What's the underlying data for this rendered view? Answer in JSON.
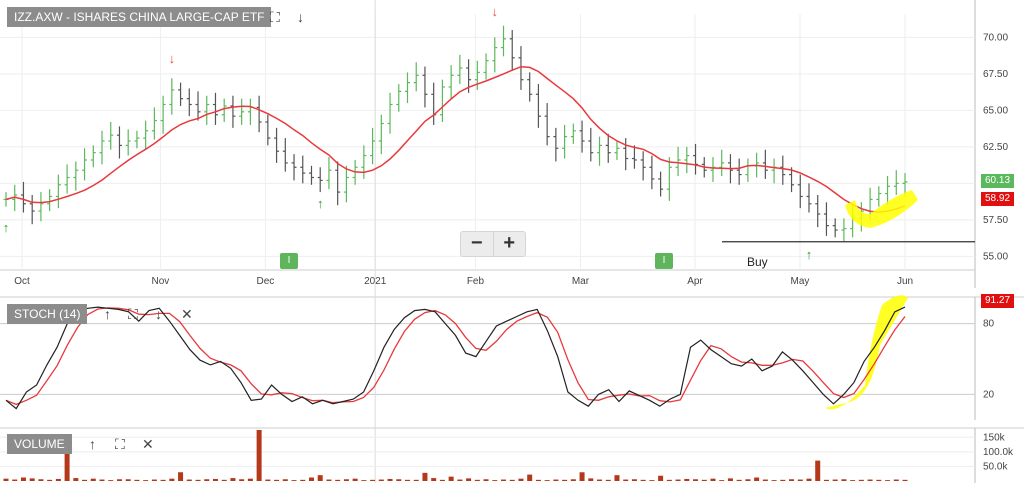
{
  "price_panel": {
    "title": "IZZ.AXW - ISHARES CHINA LARGE-CAP ETF",
    "last_price_label": "60.13",
    "sma_label": "58.92",
    "buy_label": "Buy",
    "event_badges": [
      "I",
      "I"
    ]
  },
  "stoch_panel": {
    "title": "STOCH (14)",
    "value_label": "91.27"
  },
  "volume_panel": {
    "title": "VOLUME"
  },
  "zoom": {
    "minus": "−",
    "plus": "+"
  },
  "colors": {
    "up": "#5cb85c",
    "down": "#555555",
    "sma": "#e8393d",
    "stoch_k": "#222222",
    "stoch_d": "#e8393d",
    "volume": "#b5381b",
    "highlight": "#ffff00",
    "panel_title_bg": "#8c8c8c",
    "last_tag": "#5cb85c",
    "sma_tag": "#e01010"
  },
  "chart_data": [
    {
      "type": "line",
      "name": "price",
      "x_ticks": [
        "Oct",
        "Nov",
        "Dec",
        "2021",
        "Feb",
        "Mar",
        "Apr",
        "May",
        "Jun"
      ],
      "y_ticks": [
        "55.00",
        "57.50",
        "60.00",
        "62.50",
        "65.00",
        "67.50",
        "70.00"
      ],
      "ylim": [
        54.2,
        71.6
      ],
      "grid": true,
      "series": [
        {
          "name": "close",
          "values": [
            58.9,
            59.2,
            58.6,
            58.1,
            58.6,
            59.1,
            59.9,
            60.4,
            60.9,
            61.6,
            62.1,
            62.9,
            63.3,
            62.6,
            62.9,
            63.1,
            63.6,
            64.3,
            65.4,
            66.4,
            65.8,
            65.4,
            64.9,
            65.4,
            64.7,
            65.3,
            64.6,
            64.9,
            65.2,
            64.2,
            63.1,
            62.2,
            61.4,
            61.1,
            60.7,
            60.4,
            60.2,
            60.9,
            59.4,
            60.4,
            61.1,
            61.9,
            62.9,
            64.1,
            65.4,
            66.3,
            66.9,
            67.4,
            66.1,
            64.7,
            66.6,
            67.4,
            67.9,
            67.1,
            67.6,
            68.4,
            69.3,
            69.9,
            68.6,
            67.1,
            66.1,
            64.6,
            63.2,
            62.4,
            63.2,
            63.6,
            62.9,
            62.1,
            62.6,
            62.1,
            62.4,
            61.7,
            61.6,
            61.1,
            60.3,
            59.6,
            61.1,
            61.6,
            61.9,
            61.3,
            60.9,
            61.1,
            61.4,
            60.9,
            60.6,
            61.2,
            61.4,
            60.9,
            61.1,
            60.6,
            59.9,
            59.1,
            58.6,
            57.9,
            57.1,
            56.8,
            56.9,
            57.6,
            58.1,
            58.9,
            59.3,
            59.8,
            60.0,
            60.1
          ]
        },
        {
          "name": "sma",
          "values": []
        }
      ],
      "annotations": [
        {
          "type": "down_arrow",
          "index": 20
        },
        {
          "type": "down_arrow",
          "index": 57
        },
        {
          "type": "up_arrow",
          "index": 0
        },
        {
          "type": "up_arrow",
          "index": 37
        },
        {
          "type": "up_arrow",
          "index": 93
        }
      ],
      "buy_line_value": 56.0
    },
    {
      "type": "line",
      "name": "stoch",
      "y_ticks": [
        "20",
        "80"
      ],
      "ylim": [
        0,
        100
      ],
      "series": [
        {
          "name": "k",
          "values": [
            15,
            8,
            22,
            28,
            45,
            60,
            80,
            90,
            93,
            94,
            93,
            92,
            90,
            82,
            91,
            93,
            82,
            70,
            58,
            49,
            45,
            48,
            42,
            30,
            15,
            16,
            28,
            20,
            14,
            18,
            12,
            15,
            12,
            14,
            16,
            22,
            40,
            60,
            75,
            85,
            91,
            92,
            90,
            80,
            70,
            55,
            52,
            65,
            78,
            82,
            86,
            90,
            92,
            74,
            52,
            22,
            15,
            10,
            20,
            24,
            14,
            23,
            19,
            15,
            10,
            16,
            20,
            60,
            66,
            58,
            52,
            46,
            44,
            50,
            40,
            44,
            56,
            49,
            40,
            30,
            20,
            12,
            20,
            30,
            48,
            60,
            74,
            90,
            94
          ]
        },
        {
          "name": "d",
          "values": []
        }
      ]
    },
    {
      "type": "bar",
      "name": "volume",
      "y_ticks": [
        "50.0k",
        "100.0k",
        "150k"
      ],
      "ylim": [
        0,
        175000
      ],
      "values": [
        8000,
        5000,
        12000,
        9000,
        6000,
        4000,
        7000,
        160000,
        10000,
        4000,
        8000,
        5000,
        3000,
        6000,
        6000,
        4000,
        3000,
        5000,
        4000,
        8000,
        30000,
        5000,
        4000,
        6000,
        7000,
        4000,
        10000,
        6000,
        8000,
        175000,
        5000,
        4000,
        6000,
        3000,
        4000,
        12000,
        20000,
        5000,
        4000,
        6000,
        8000,
        3000,
        4000,
        5000,
        7000,
        6000,
        4000,
        4000,
        28000,
        10000,
        4000,
        15000,
        5000,
        9000,
        4000,
        6000,
        3000,
        5000,
        4000,
        8000,
        22000,
        4000,
        3000,
        5000,
        4000,
        6000,
        30000,
        9000,
        5000,
        4000,
        20000,
        5000,
        6000,
        4000,
        3000,
        18000,
        4000,
        5000,
        7000,
        6000,
        4000,
        8000,
        3000,
        9000,
        4000,
        6000,
        12000,
        5000,
        3000,
        4000,
        6000,
        5000,
        8000,
        70000,
        4000,
        5000,
        6000,
        3000,
        4000,
        5000,
        4000,
        3000,
        5000,
        4000
      ]
    }
  ]
}
